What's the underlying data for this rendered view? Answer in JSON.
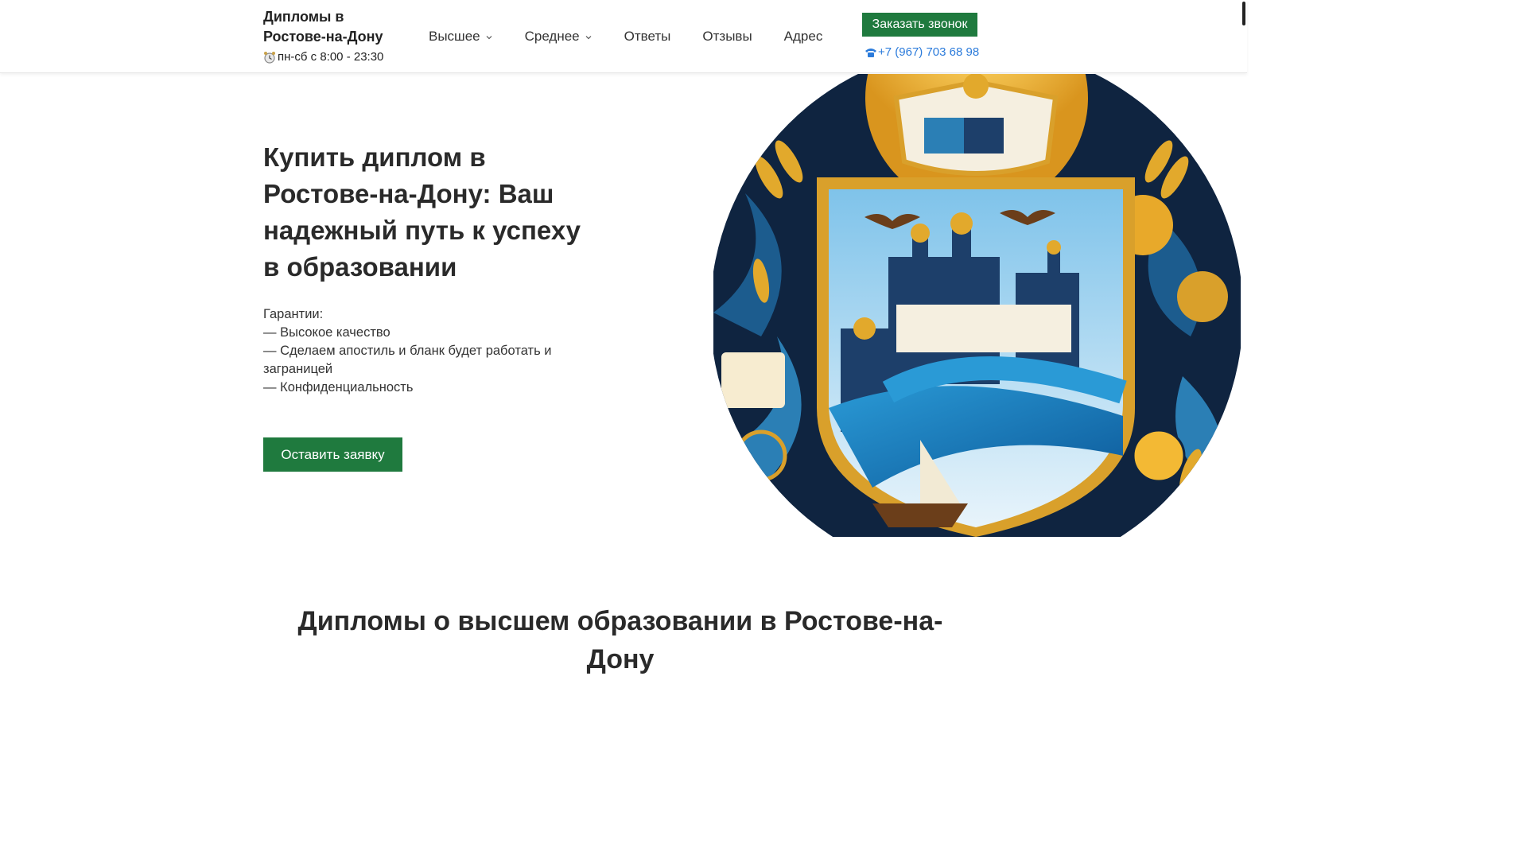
{
  "header": {
    "brand_title": "Дипломы в Ростове-на-Дону",
    "hours": "пн-сб с 8:00 - 23:30",
    "nav": [
      {
        "label": "Высшее",
        "has_dropdown": true
      },
      {
        "label": "Среднее",
        "has_dropdown": true
      },
      {
        "label": "Ответы",
        "has_dropdown": false
      },
      {
        "label": "Отзывы",
        "has_dropdown": false
      },
      {
        "label": "Адрес",
        "has_dropdown": false
      }
    ],
    "call_button": "Заказать звонок",
    "phone": "+7 (967) 703 68 98"
  },
  "hero": {
    "title": "Купить диплом в Ростове-на-Дону: Ваш надежный путь к успеху в образовании",
    "guarantees": [
      "Гарантии:",
      "— Высокое качество",
      "— Сделаем апостиль и бланк будет работать и заграницей",
      "— Конфиденциальность"
    ],
    "cta": "Оставить заявку"
  },
  "section": {
    "title": "Дипломы о высшем образовании в Ростове-на-Дону"
  },
  "colors": {
    "accent": "#1f7a3e",
    "link": "#2b7bdb",
    "text": "#2a2a2a"
  },
  "icons": {
    "clock": "alarm-clock-icon",
    "phone": "telephone-icon",
    "dropdown": "chevron-down-icon"
  }
}
